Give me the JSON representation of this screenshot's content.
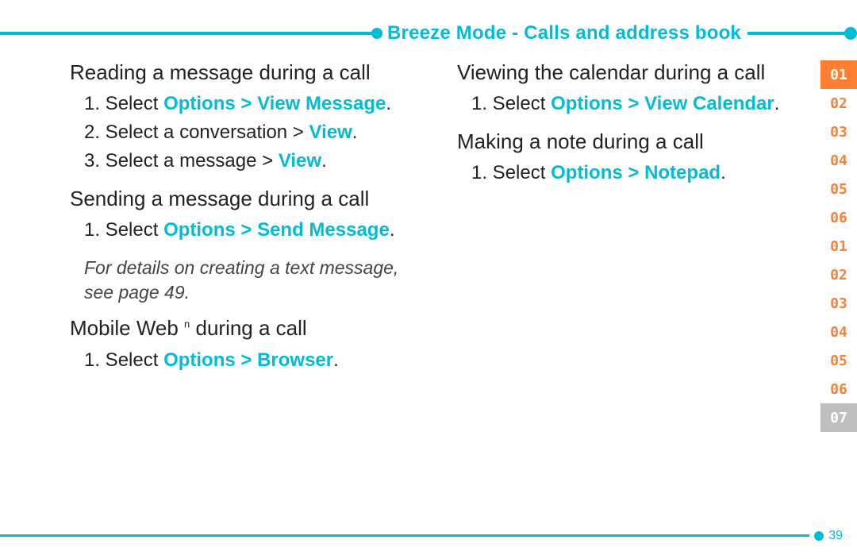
{
  "header": {
    "title": "Breeze Mode - Calls and address book"
  },
  "sections": {
    "reading": {
      "title": "Reading a message during a call",
      "step1_prefix": "1. Select ",
      "step1_accent": "Options > View Message",
      "step1_suffix": ".",
      "step2_prefix": "2. Select a conversation > ",
      "step2_accent": "View",
      "step2_suffix": ".",
      "step3_prefix": "3. Select a message > ",
      "step3_accent": "View",
      "step3_suffix": "."
    },
    "sending": {
      "title": "Sending a message during a call",
      "step1_prefix": "1. Select ",
      "step1_accent": "Options > Send Message",
      "step1_suffix": ".",
      "note": "For details on creating a text message, see page 49."
    },
    "mobileweb": {
      "title_pre": "Mobile Web ",
      "title_sup": "n",
      "title_post": " during a call",
      "step1_prefix": "1. Select ",
      "step1_accent": "Options > Browser",
      "step1_suffix": "."
    },
    "calendar": {
      "title": "Viewing the calendar during a call",
      "step1_prefix": "1. Select ",
      "step1_accent": "Options > View Calendar",
      "step1_suffix": "."
    },
    "note": {
      "title": "Making a note during a call",
      "step1_prefix": "1. Select ",
      "step1_accent": "Options > Notepad",
      "step1_suffix": "."
    }
  },
  "tabs": [
    "01",
    "02",
    "03",
    "04",
    "05",
    "06",
    "01",
    "02",
    "03",
    "04",
    "05",
    "06",
    "07"
  ],
  "page_number": "39"
}
